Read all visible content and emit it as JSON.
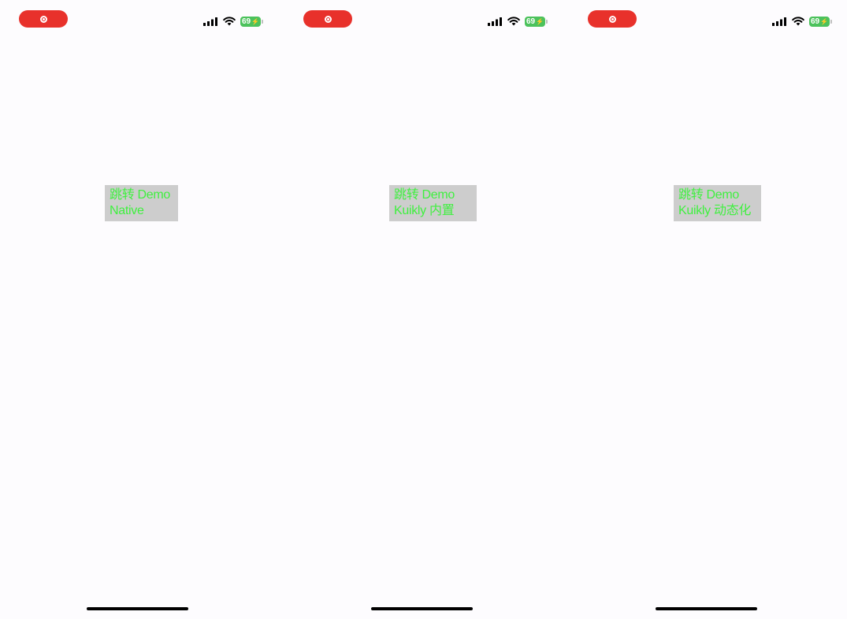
{
  "colors": {
    "background": "#fdfcfe",
    "record_pill": "#e8312b",
    "battery": "#4cc25c",
    "button_bg": "#cdcdcd",
    "button_text": "#3ff03f",
    "home_indicator": "#000000"
  },
  "screens": [
    {
      "status": {
        "battery_level": "69",
        "icons": [
          "record-icon",
          "signal-icon",
          "wifi-icon",
          "battery-charging-icon"
        ]
      },
      "button": {
        "line1": "跳转 Demo",
        "line2": "Native"
      }
    },
    {
      "status": {
        "battery_level": "69",
        "icons": [
          "record-icon",
          "signal-icon",
          "wifi-icon",
          "battery-charging-icon"
        ]
      },
      "button": {
        "line1": "跳转 Demo",
        "line2": "Kuikly 内置"
      }
    },
    {
      "status": {
        "battery_level": "69",
        "icons": [
          "record-icon",
          "signal-icon",
          "wifi-icon",
          "battery-charging-icon"
        ]
      },
      "button": {
        "line1": "跳转 Demo",
        "line2": "Kuikly 动态化"
      }
    }
  ]
}
